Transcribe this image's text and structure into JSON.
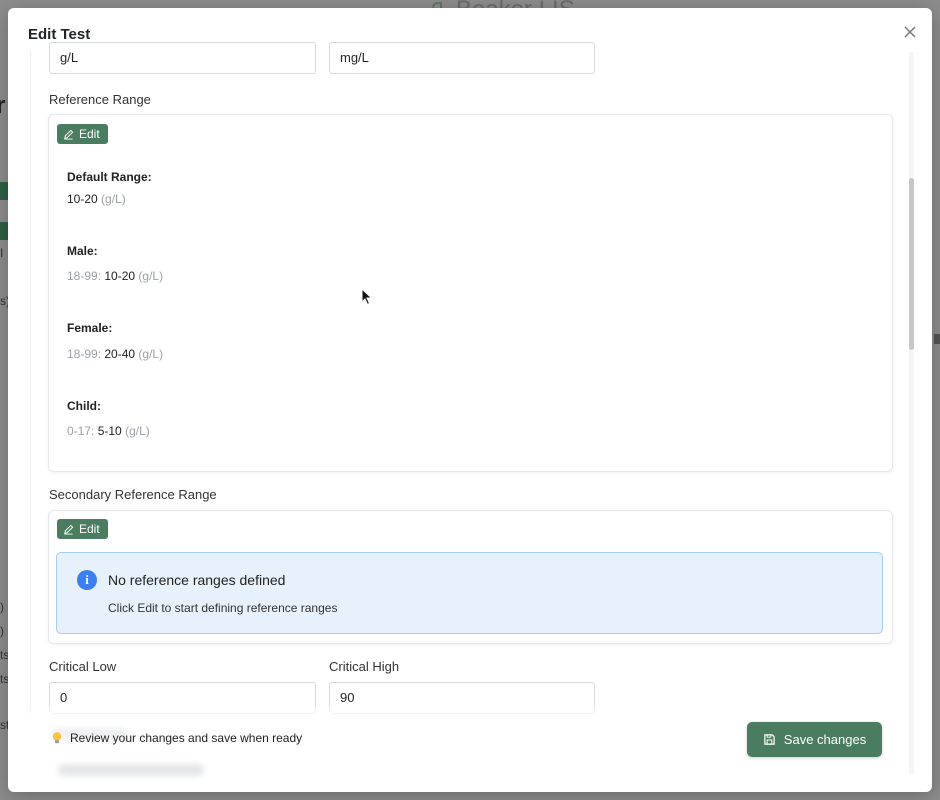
{
  "background": {
    "app_name": "Beaker LIS"
  },
  "modal": {
    "title": "Edit Test",
    "close_icon": "close-icon"
  },
  "units": {
    "unit_value": "g/L",
    "secondary_unit_value": "mg/L"
  },
  "reference_range": {
    "label": "Reference Range",
    "edit_label": "Edit",
    "default": {
      "title": "Default Range:",
      "value": "10-20",
      "unit": "(g/L)"
    },
    "male": {
      "title": "Male:",
      "age": "18-99:",
      "value": "10-20",
      "unit": "(g/L)"
    },
    "female": {
      "title": "Female:",
      "age": "18-99:",
      "value": "20-40",
      "unit": "(g/L)"
    },
    "child": {
      "title": "Child:",
      "age": "0-17:",
      "value": "5-10",
      "unit": "(g/L)"
    }
  },
  "secondary_reference_range": {
    "label": "Secondary Reference Range",
    "edit_label": "Edit",
    "empty_title": "No reference ranges defined",
    "empty_subtitle": "Click Edit to start defining reference ranges",
    "info_icon": "i"
  },
  "critical": {
    "low_label": "Critical Low",
    "low_value": "0",
    "high_label": "Critical High",
    "high_value": "90"
  },
  "footer": {
    "hint": "Review your changes and save when ready",
    "save_label": "Save changes"
  },
  "colors": {
    "primary": "#4a7d60",
    "info_bg": "#e7f1fc",
    "info_border": "#a8cdf3",
    "info_icon": "#3d7ef0"
  }
}
